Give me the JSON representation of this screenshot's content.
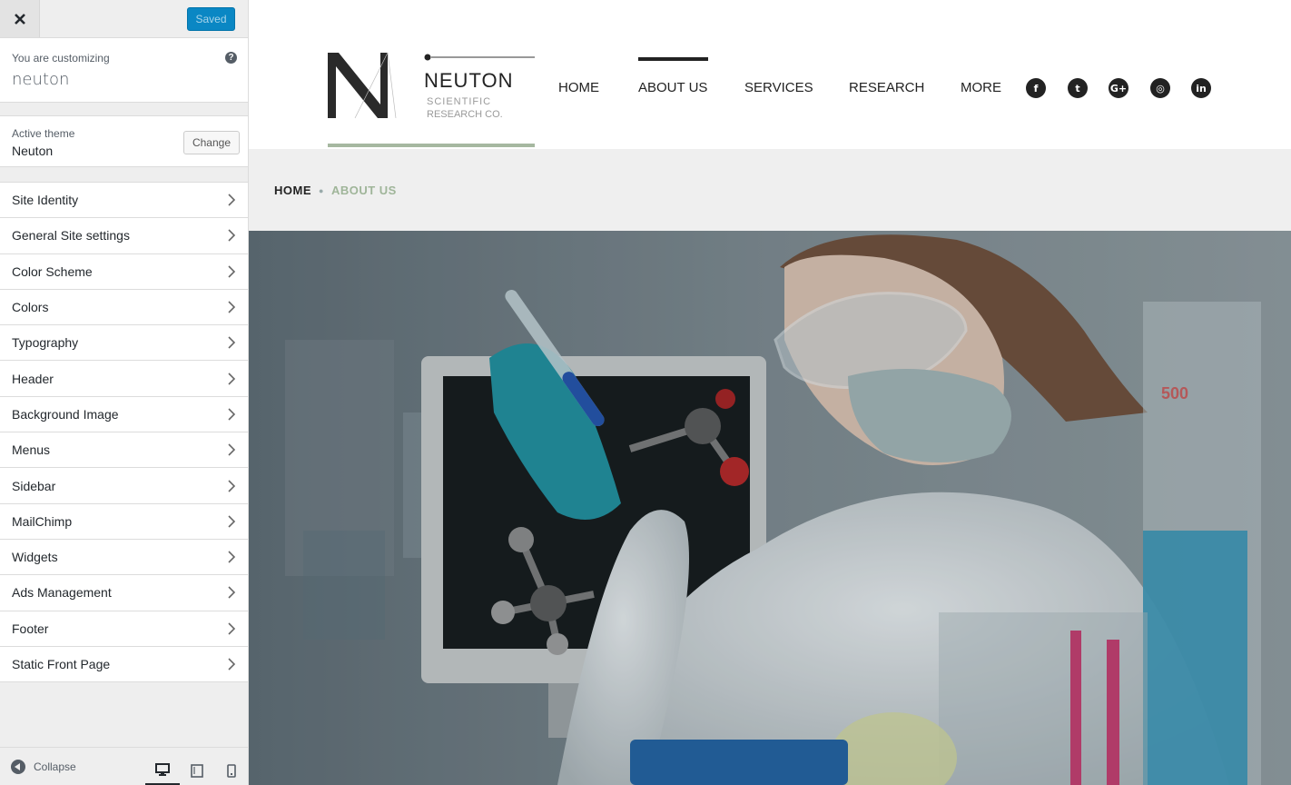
{
  "customizer": {
    "saved_label": "Saved",
    "customizing_label": "You are customizing",
    "site_name": "neuton",
    "help_icon": "question-circle-icon",
    "active_theme_label": "Active theme",
    "active_theme_name": "Neuton",
    "change_label": "Change",
    "sections": [
      {
        "label": "Site Identity"
      },
      {
        "label": "General Site settings"
      },
      {
        "label": "Color Scheme"
      },
      {
        "label": "Colors"
      },
      {
        "label": "Typography"
      },
      {
        "label": "Header"
      },
      {
        "label": "Background Image"
      },
      {
        "label": "Menus"
      },
      {
        "label": "Sidebar"
      },
      {
        "label": "MailChimp"
      },
      {
        "label": "Widgets"
      },
      {
        "label": "Ads Management"
      },
      {
        "label": "Footer"
      },
      {
        "label": "Static Front Page"
      }
    ],
    "collapse_label": "Collapse",
    "devices": [
      "desktop-icon",
      "tablet-icon",
      "mobile-icon"
    ]
  },
  "site": {
    "logo": {
      "word": "NEUTON",
      "sub1": "SCIENTIFIC",
      "sub2": "RESEARCH CO."
    },
    "nav": [
      {
        "label": "HOME"
      },
      {
        "label": "ABOUT US"
      },
      {
        "label": "SERVICES"
      },
      {
        "label": "RESEARCH"
      },
      {
        "label": "MORE"
      }
    ],
    "active_nav": "ABOUT US",
    "social": [
      {
        "icon": "facebook-icon",
        "glyph": "f"
      },
      {
        "icon": "twitter-icon",
        "glyph": "t"
      },
      {
        "icon": "google-plus-icon",
        "glyph": "G+"
      },
      {
        "icon": "instagram-icon",
        "glyph": "◎"
      },
      {
        "icon": "linkedin-icon",
        "glyph": "in"
      }
    ],
    "breadcrumb": {
      "home": "HOME",
      "current": "ABOUT US"
    },
    "hero_beaker_text": "500"
  },
  "colors": {
    "accent_blue": "#0a87c4",
    "breadcrumb_green": "#9fb599",
    "logo_underline": "#a6b8a0"
  }
}
